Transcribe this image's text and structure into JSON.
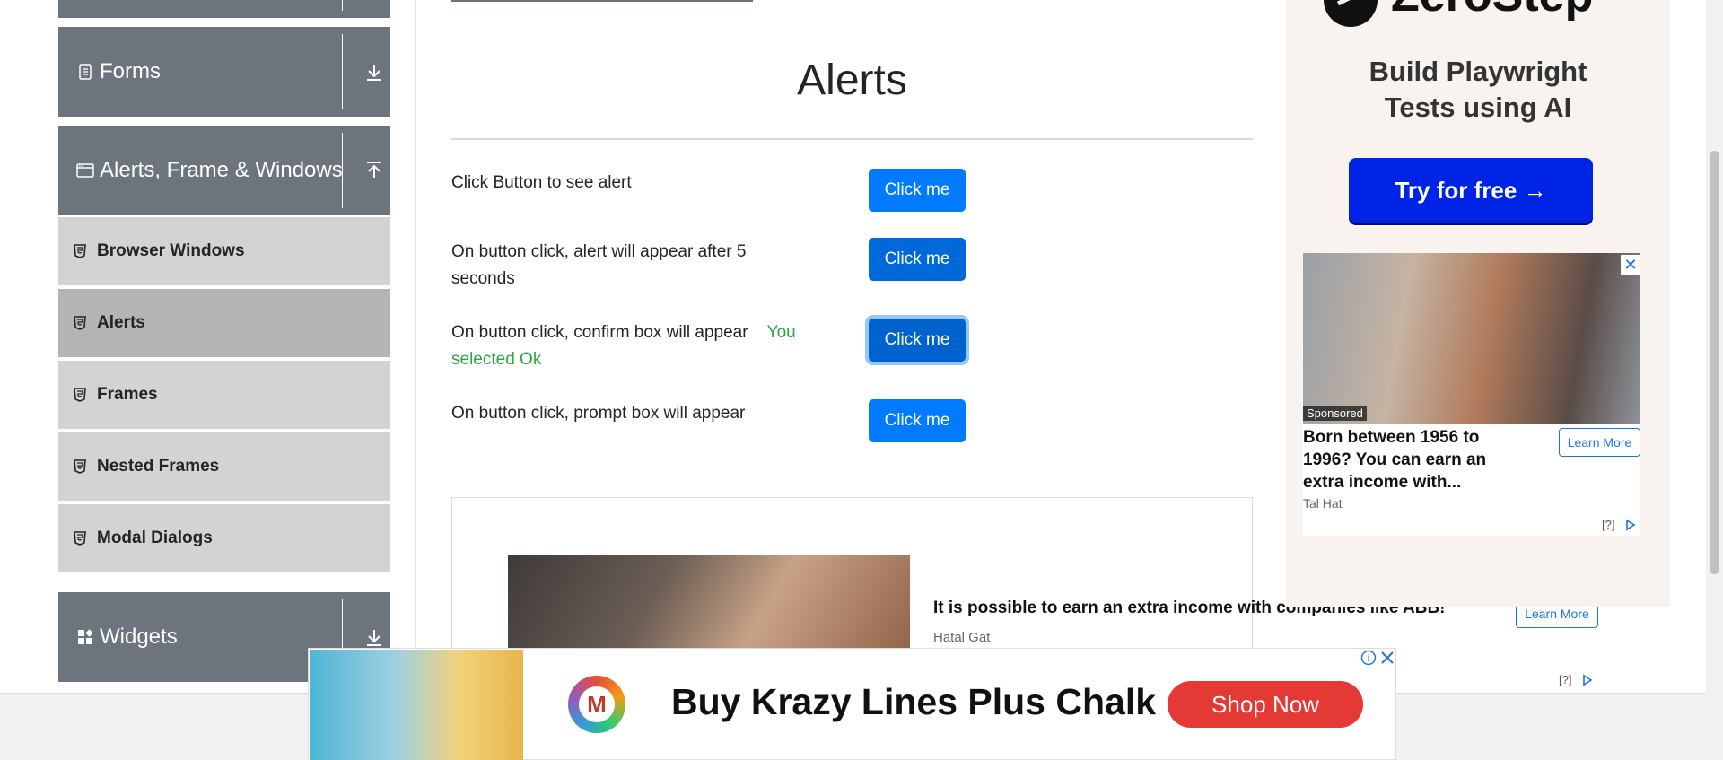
{
  "sidebar": {
    "groups": [
      {
        "label": "Forms",
        "icon": "document-icon",
        "arrow": "download-arrow-icon"
      },
      {
        "label": "Alerts, Frame & Windows",
        "icon": "window-icon",
        "arrow": "upload-arrow-icon"
      },
      {
        "label": "Widgets",
        "icon": "grid-icon",
        "arrow": "download-arrow-icon"
      }
    ],
    "items": [
      {
        "label": "Browser Windows"
      },
      {
        "label": "Alerts"
      },
      {
        "label": "Frames"
      },
      {
        "label": "Nested Frames"
      },
      {
        "label": "Modal Dialogs"
      }
    ],
    "active_item": "Alerts"
  },
  "main": {
    "title": "Alerts",
    "rows": [
      {
        "text": "Click Button to see alert",
        "button": "Click me"
      },
      {
        "text": "On button click, alert will appear after 5 seconds",
        "button": "Click me"
      },
      {
        "text": "On button click, confirm box will appear",
        "result": "You selected Ok",
        "button": "Click me"
      },
      {
        "text": "On button click, prompt box will appear",
        "button": "Click me"
      }
    ]
  },
  "inline_ad": {
    "title": "It is possible to earn an extra income with companies like ABB!",
    "source": "Hatal Gat",
    "learn_more": "Learn More",
    "info": "[?]"
  },
  "right_ad": {
    "brand": "ZeroStep",
    "headline_line1": "Build Playwright",
    "headline_line2": "Tests using AI",
    "cta": "Try for free →",
    "sub_ad": {
      "sponsored": "Sponsored",
      "title": "Born between 1956 to 1996? You can earn an extra income with...",
      "source": "Tal Hat",
      "learn_more": "Learn More",
      "info": "[?]",
      "close": "✕"
    }
  },
  "bottom_banner": {
    "title": "Buy Krazy Lines Plus Chalk",
    "cta": "Shop Now",
    "logo_letter": "M"
  },
  "colors": {
    "sidebar_header": "#6c757d",
    "menu_item": "#d3d3d3",
    "menu_active": "#b4b4b4",
    "button": "#007bff",
    "success": "#28a745",
    "cta_blue": "#0024e6",
    "shop_red": "#e53935"
  }
}
